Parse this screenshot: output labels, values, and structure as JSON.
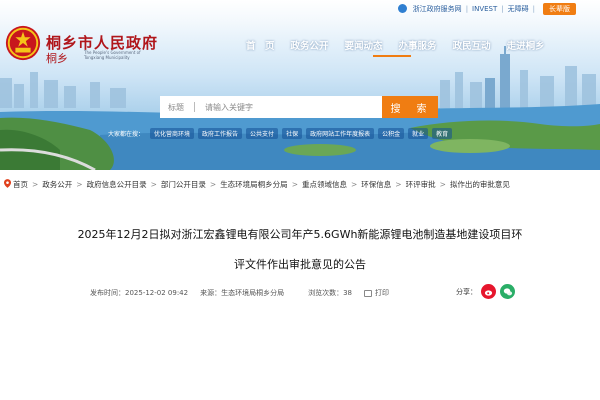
{
  "topbar": {
    "links": [
      "浙江政府服务网",
      "INVEST",
      "无障碍"
    ],
    "elder_button": "长辈版"
  },
  "site": {
    "title": "桐乡市人民政府",
    "subtitle": "桐乡",
    "english": "The People's Government of Tongxiang Municipality"
  },
  "nav": {
    "items": [
      "首　页",
      "政务公开",
      "要闻动态",
      "办事服务",
      "政民互动",
      "走进桐乡"
    ],
    "active_index": 2
  },
  "search": {
    "scope": "标题",
    "placeholder": "请输入关键字",
    "button": "搜　索"
  },
  "hot": {
    "label": "大家都在搜：",
    "chips": [
      "优化营商环境",
      "政府工作报告",
      "公共支付",
      "社保",
      "政府网站工作年度报表",
      "公积金",
      "就业",
      "教育"
    ]
  },
  "breadcrumb": [
    "首页",
    "政务公开",
    "政府信息公开目录",
    "部门公开目录",
    "生态环境局桐乡分局",
    "重点领域信息",
    "环保信息",
    "环评审批",
    "拟作出的审批意见"
  ],
  "article": {
    "title_line1": "2025年12月2日拟对浙江宏鑫锂电有限公司年产5.6GWh新能源锂电池制造基地建设项目环",
    "title_line2": "评文件作出审批意见的公告",
    "publish_label": "发布时间：",
    "publish_time": "2025-12-02  09:42",
    "source_label": "来源：",
    "source": "生态环境局桐乡分局",
    "views_label": "浏览次数：",
    "views": "38",
    "print_label": "打印",
    "share_label": "分享："
  },
  "colors": {
    "brand_red": "#b0161b",
    "accent_orange": "#f07d12",
    "link_blue": "#2b5f9e"
  },
  "icons": [
    "location-pin-icon",
    "weibo-icon",
    "wechat-icon",
    "print-icon",
    "search-divider",
    "government-emblem-icon"
  ]
}
